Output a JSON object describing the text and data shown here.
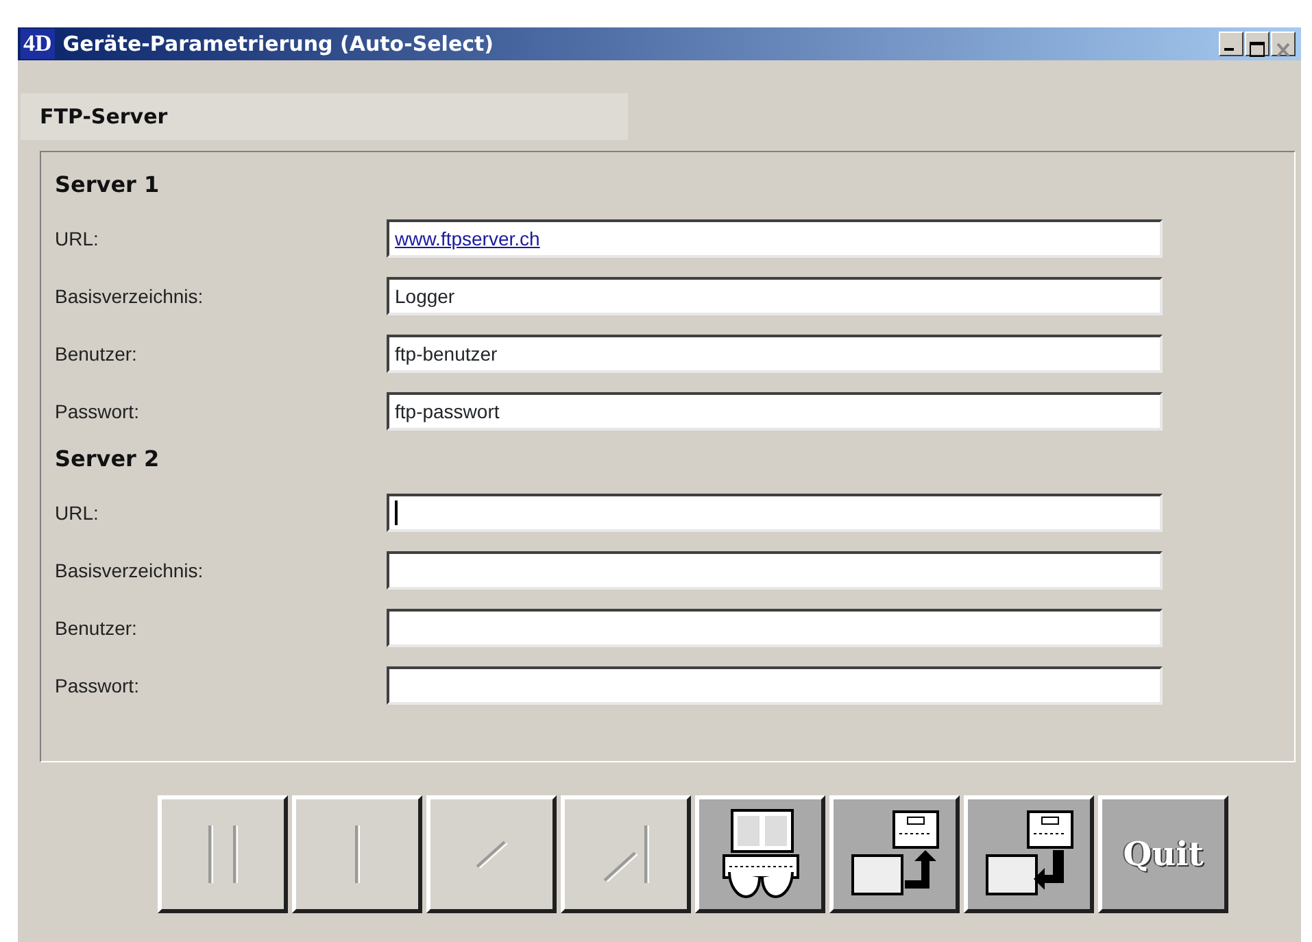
{
  "window": {
    "title": "Geräte-Parametrierung (Auto-Select)",
    "logo": "4D"
  },
  "tab": {
    "label": "FTP-Server"
  },
  "servers": [
    {
      "heading": "Server 1",
      "fields": [
        {
          "label": "URL:",
          "value": "www.ftpserver.ch",
          "kind": "link",
          "focused": false
        },
        {
          "label": "Basisverzeichnis:",
          "value": "Logger",
          "kind": "text",
          "focused": false
        },
        {
          "label": "Benutzer:",
          "value": "ftp-benutzer",
          "kind": "text",
          "focused": false
        },
        {
          "label": "Passwort:",
          "value": "ftp-passwort",
          "kind": "text",
          "focused": false
        }
      ]
    },
    {
      "heading": "Server 2",
      "fields": [
        {
          "label": "URL:",
          "kind": "text",
          "focused": true
        },
        {
          "label": "Basisverzeichnis:",
          "kind": "text",
          "focused": false
        },
        {
          "label": "Benutzer:",
          "kind": "text",
          "focused": false
        },
        {
          "label": "Passwort:",
          "kind": "text",
          "focused": false
        }
      ]
    }
  ],
  "toolbar": [
    {
      "kind": "first",
      "disabled": true
    },
    {
      "kind": "previous",
      "disabled": true
    },
    {
      "kind": "next",
      "disabled": true
    },
    {
      "kind": "last",
      "disabled": true
    },
    {
      "kind": "keyboard",
      "disabled": false
    },
    {
      "kind": "export",
      "disabled": false
    },
    {
      "kind": "import",
      "disabled": false
    },
    {
      "kind": "quit",
      "label": "Quit",
      "disabled": false
    }
  ]
}
